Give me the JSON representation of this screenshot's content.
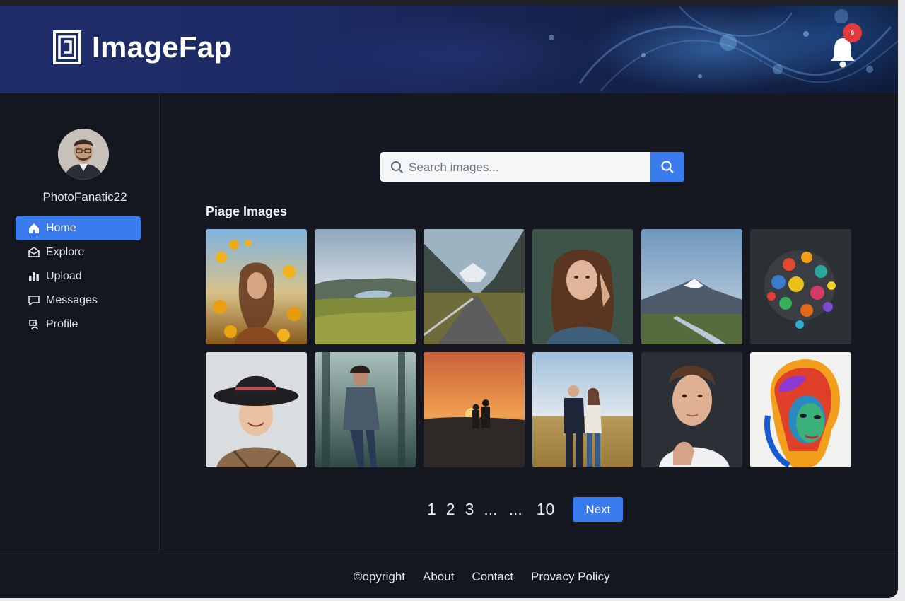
{
  "app": {
    "name": "ImageFap",
    "notification_count": "9"
  },
  "user": {
    "username": "PhotoFanatic22"
  },
  "sidebar": {
    "items": [
      {
        "label": "Home",
        "icon": "home-icon",
        "active": true
      },
      {
        "label": "Explore",
        "icon": "explore-icon",
        "active": false
      },
      {
        "label": "Upload",
        "icon": "upload-icon",
        "active": false
      },
      {
        "label": "Messages",
        "icon": "messages-icon",
        "active": false
      },
      {
        "label": "Profile",
        "icon": "profile-icon",
        "active": false
      }
    ]
  },
  "search": {
    "placeholder": "Search images...",
    "value": ""
  },
  "gallery": {
    "title": "Piage Images",
    "images": [
      "woman-in-sunflowers",
      "river-valley-landscape",
      "mountain-road",
      "woman-portrait",
      "snowy-mountain-stream",
      "colorful-paint-splash",
      "girl-in-hat",
      "man-in-forest",
      "sunset-couple",
      "couple-in-field",
      "man-portrait",
      "rainbow-face-art"
    ]
  },
  "pagination": {
    "pages": [
      "1",
      "2",
      "3",
      "...",
      "...",
      "10"
    ],
    "next_label": "Next"
  },
  "footer": {
    "links": [
      "©opyright",
      "About",
      "Contact",
      "Provacy Policy"
    ]
  },
  "colors": {
    "accent": "#3a7bed",
    "background": "#151821",
    "badge": "#e23b3b"
  }
}
